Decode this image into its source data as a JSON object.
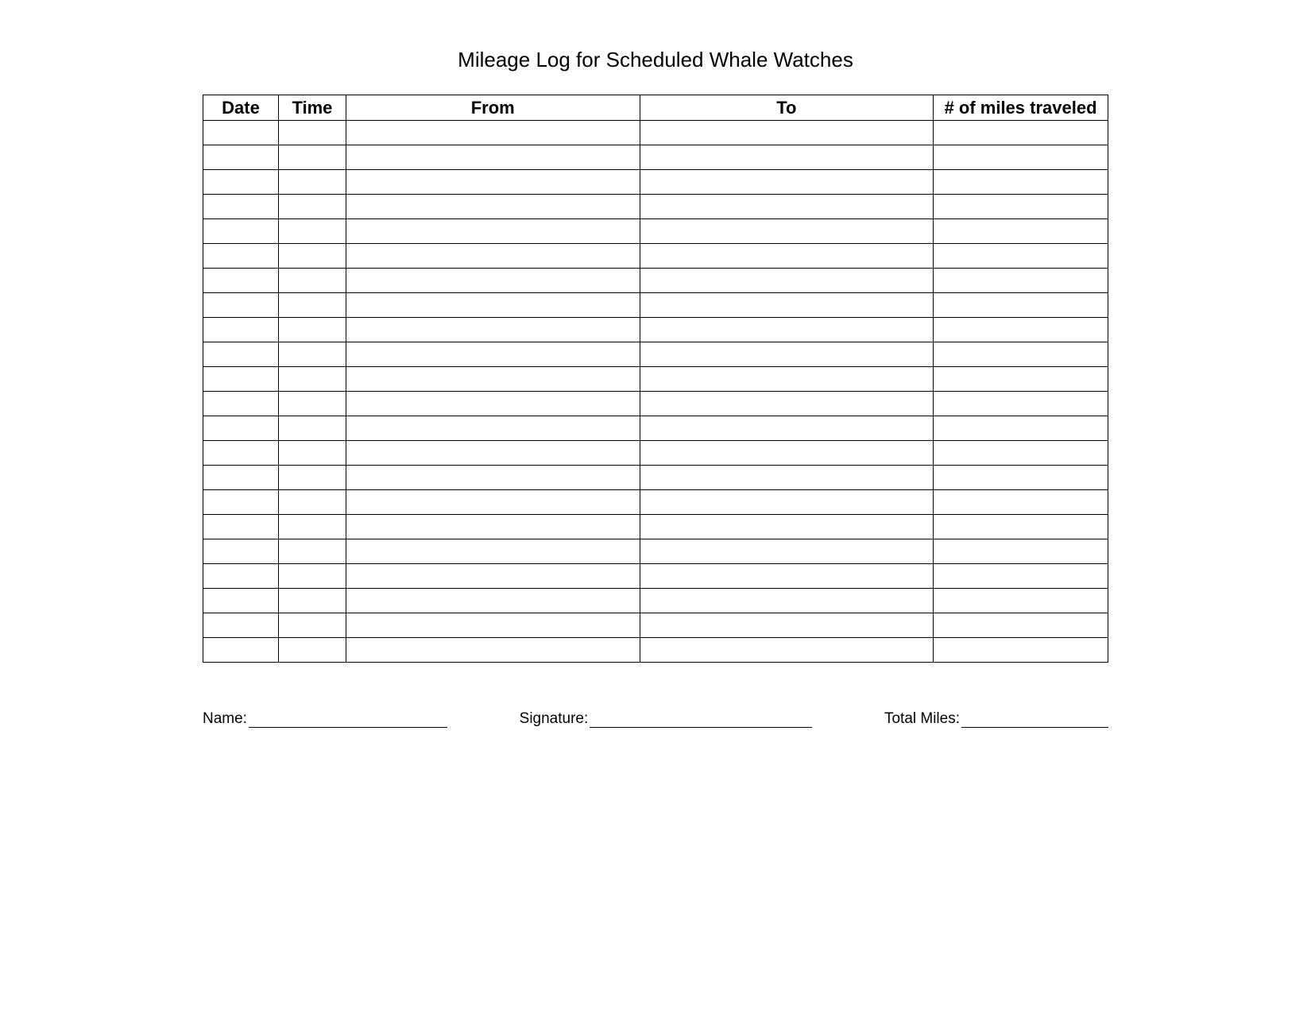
{
  "title": "Mileage Log for Scheduled Whale Watches",
  "columns": {
    "date": "Date",
    "time": "Time",
    "from": "From",
    "to": "To",
    "miles": "# of miles traveled"
  },
  "rows": [
    {
      "date": "",
      "time": "",
      "from": "",
      "to": "",
      "miles": ""
    },
    {
      "date": "",
      "time": "",
      "from": "",
      "to": "",
      "miles": ""
    },
    {
      "date": "",
      "time": "",
      "from": "",
      "to": "",
      "miles": ""
    },
    {
      "date": "",
      "time": "",
      "from": "",
      "to": "",
      "miles": ""
    },
    {
      "date": "",
      "time": "",
      "from": "",
      "to": "",
      "miles": ""
    },
    {
      "date": "",
      "time": "",
      "from": "",
      "to": "",
      "miles": ""
    },
    {
      "date": "",
      "time": "",
      "from": "",
      "to": "",
      "miles": ""
    },
    {
      "date": "",
      "time": "",
      "from": "",
      "to": "",
      "miles": ""
    },
    {
      "date": "",
      "time": "",
      "from": "",
      "to": "",
      "miles": ""
    },
    {
      "date": "",
      "time": "",
      "from": "",
      "to": "",
      "miles": ""
    },
    {
      "date": "",
      "time": "",
      "from": "",
      "to": "",
      "miles": ""
    },
    {
      "date": "",
      "time": "",
      "from": "",
      "to": "",
      "miles": ""
    },
    {
      "date": "",
      "time": "",
      "from": "",
      "to": "",
      "miles": ""
    },
    {
      "date": "",
      "time": "",
      "from": "",
      "to": "",
      "miles": ""
    },
    {
      "date": "",
      "time": "",
      "from": "",
      "to": "",
      "miles": ""
    },
    {
      "date": "",
      "time": "",
      "from": "",
      "to": "",
      "miles": ""
    },
    {
      "date": "",
      "time": "",
      "from": "",
      "to": "",
      "miles": ""
    },
    {
      "date": "",
      "time": "",
      "from": "",
      "to": "",
      "miles": ""
    },
    {
      "date": "",
      "time": "",
      "from": "",
      "to": "",
      "miles": ""
    },
    {
      "date": "",
      "time": "",
      "from": "",
      "to": "",
      "miles": ""
    },
    {
      "date": "",
      "time": "",
      "from": "",
      "to": "",
      "miles": ""
    },
    {
      "date": "",
      "time": "",
      "from": "",
      "to": "",
      "miles": ""
    }
  ],
  "footer": {
    "name_label": "Name:",
    "signature_label": "Signature:",
    "total_label": "Total Miles:"
  }
}
